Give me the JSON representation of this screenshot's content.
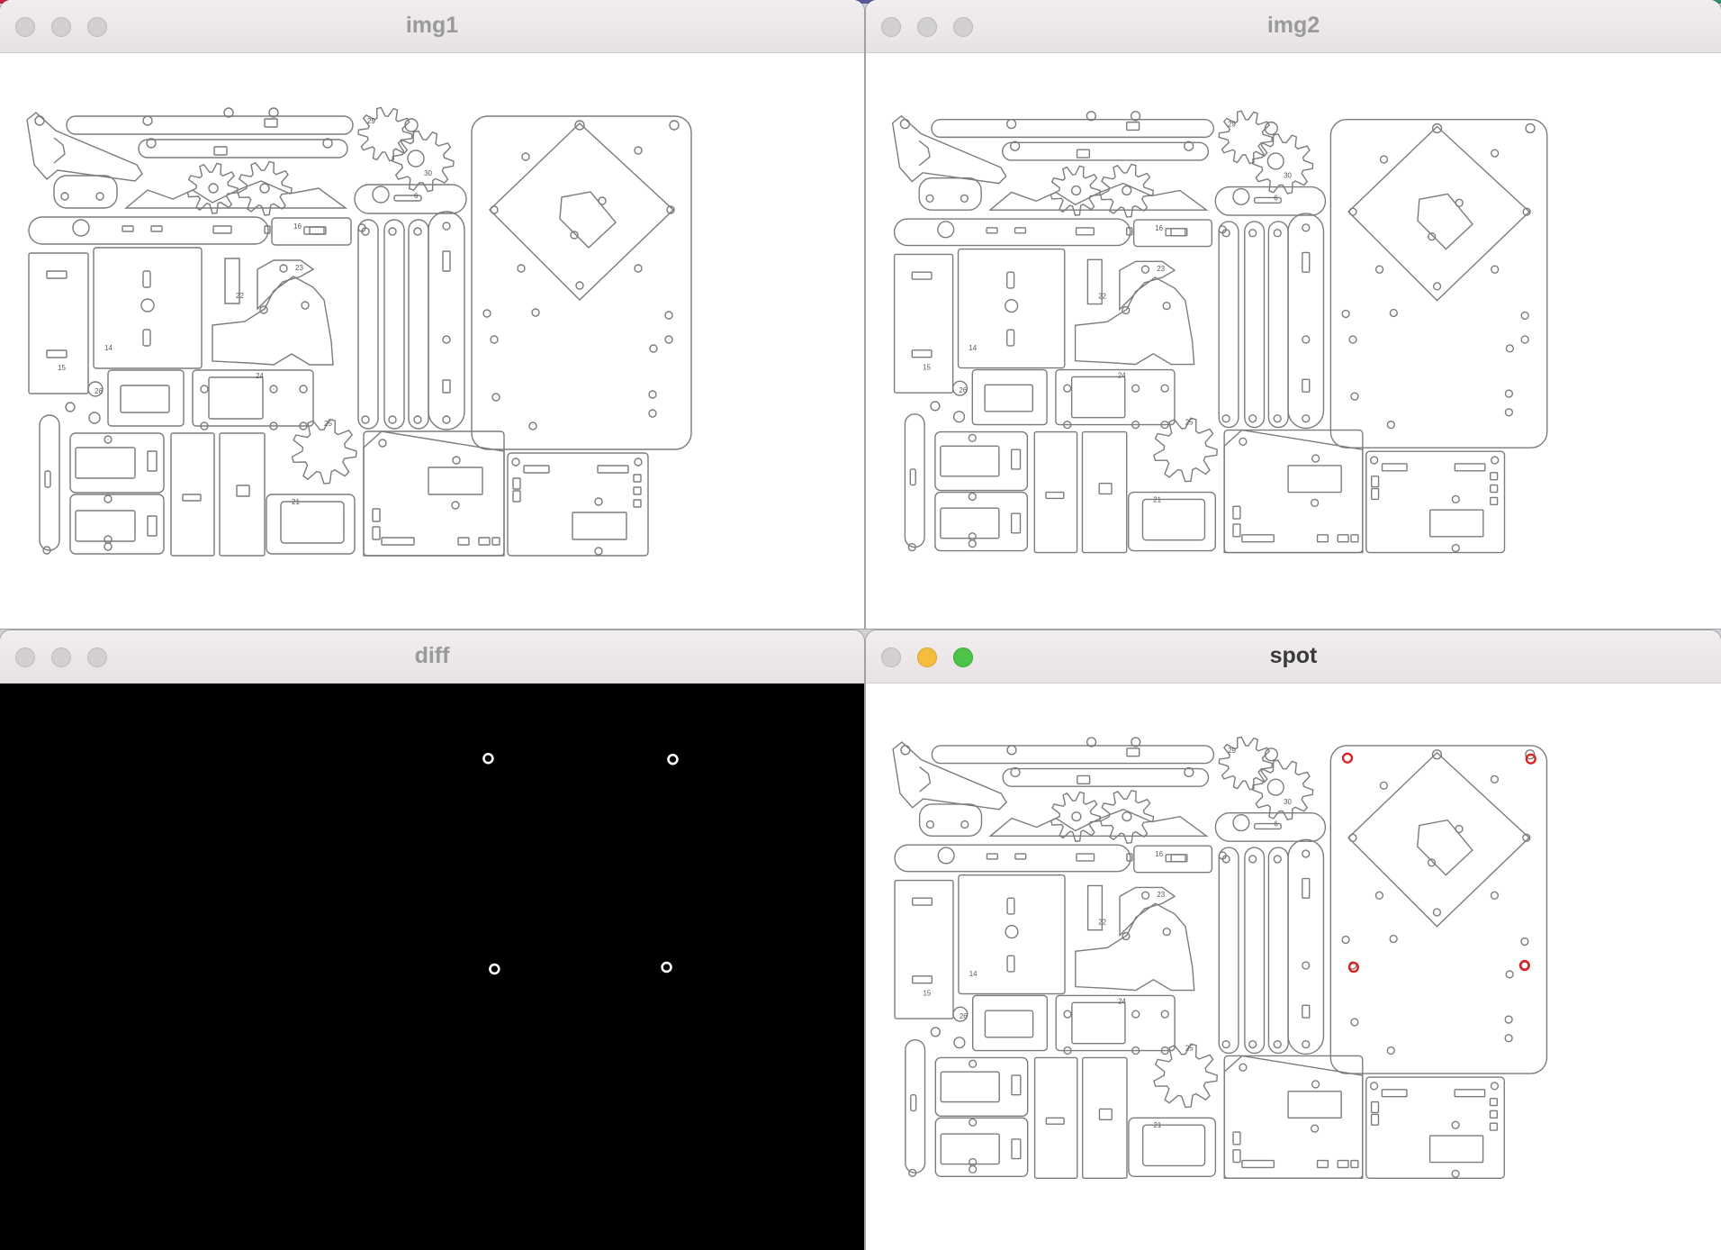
{
  "windows": {
    "img1": {
      "title": "img1"
    },
    "img2": {
      "title": "img2"
    },
    "diff": {
      "title": "diff"
    },
    "spot": {
      "title": "spot"
    }
  },
  "part_labels": [
    "29",
    "30",
    "6",
    "16",
    "22",
    "23",
    "14",
    "15",
    "24",
    "25",
    "21",
    "26"
  ],
  "colors": {
    "line": "#7b7b7b",
    "highlight": "#e02020",
    "diff_bg": "#000000",
    "diff_mark": "#ffffff"
  },
  "changed_holes": [
    {
      "name": "hole-top-left"
    },
    {
      "name": "hole-top-right"
    },
    {
      "name": "hole-mid-left"
    },
    {
      "name": "hole-mid-right"
    }
  ]
}
